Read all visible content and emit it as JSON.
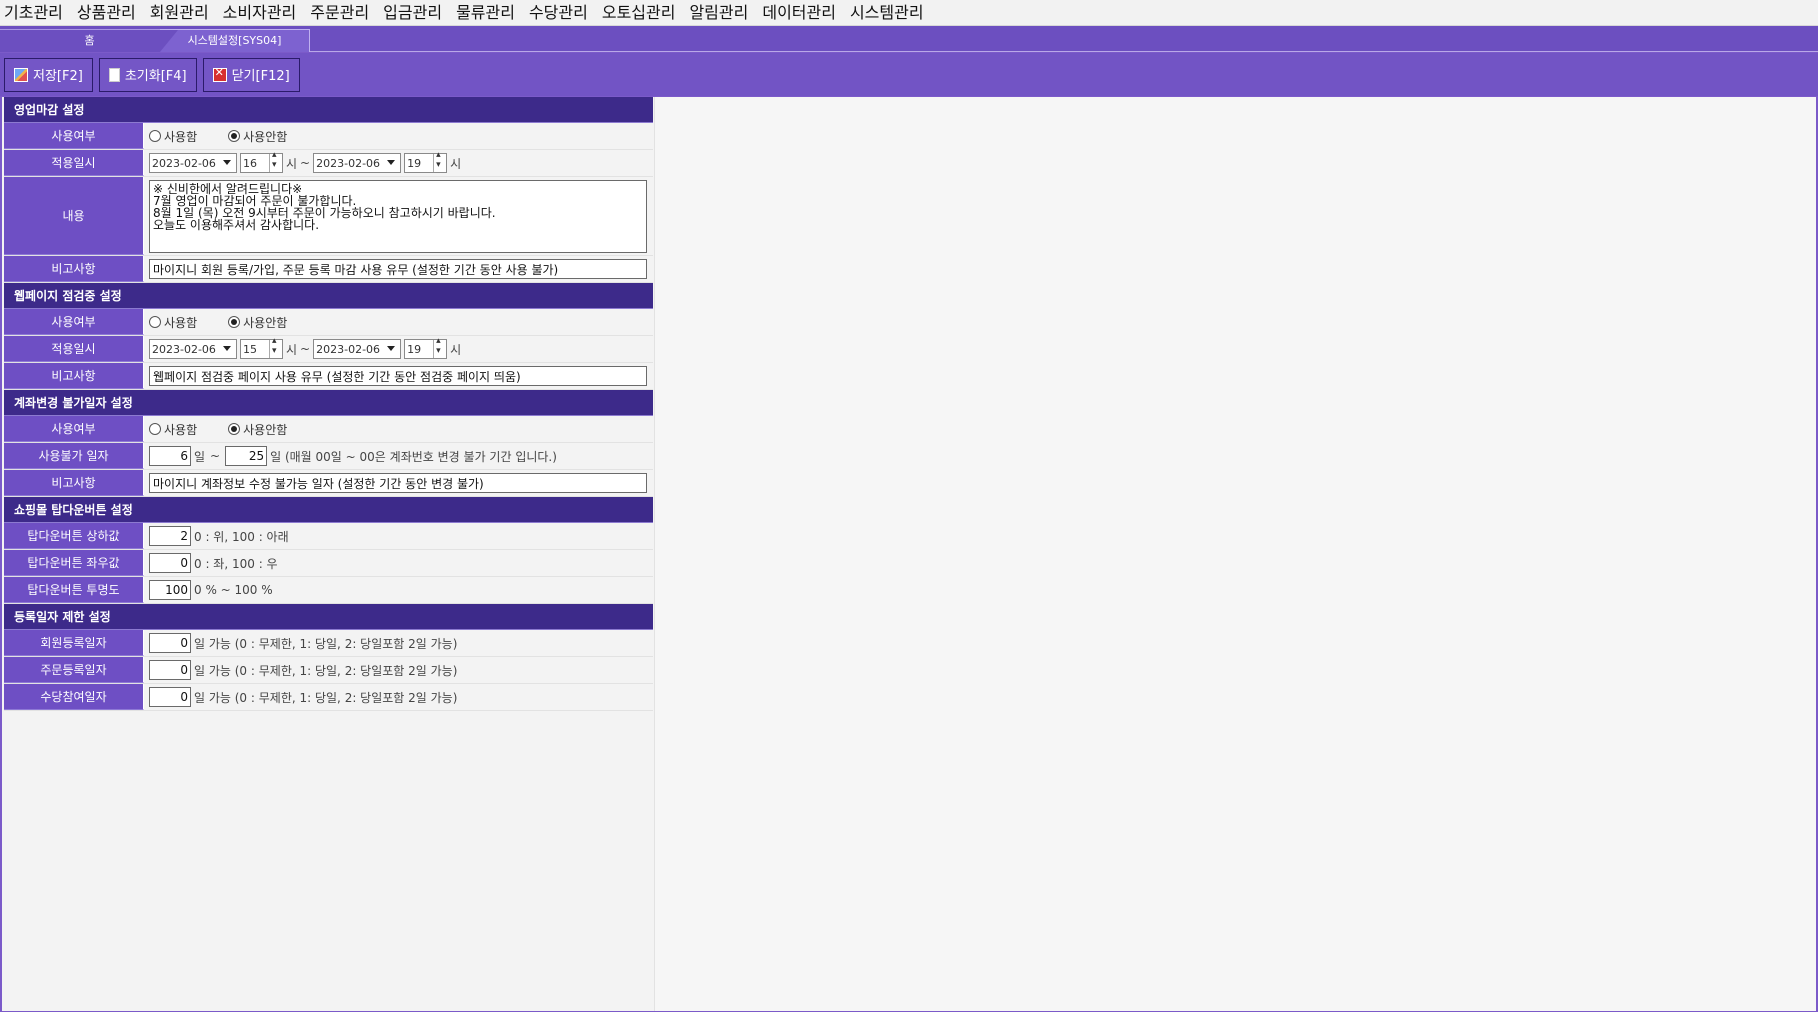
{
  "menu": [
    "기초관리",
    "상품관리",
    "회원관리",
    "소비자관리",
    "주문관리",
    "입금관리",
    "물류관리",
    "수당관리",
    "오토십관리",
    "알림관리",
    "데이터관리",
    "시스템관리"
  ],
  "tabs": {
    "home": "홈",
    "active": "시스템설정[SYS04]"
  },
  "toolbar": {
    "save": "저장[F2]",
    "reset": "초기화[F4]",
    "close": "닫기[F12]"
  },
  "radio": {
    "use": "사용함",
    "nouse": "사용안함"
  },
  "units": {
    "hour": "시",
    "tilde": "~",
    "day": "일"
  },
  "business_close": {
    "title": "영업마감 설정",
    "use_label": "사용여부",
    "period_label": "적용일시",
    "start_date": "2023-02-06",
    "start_hour": "16",
    "end_date": "2023-02-06",
    "end_hour": "19",
    "content_label": "내용",
    "content": "※ 신비한에서 알려드립니다※\n7월 영업이 마감되어 주문이 불가합니다.\n8월 1일 (목) 오전 9시부터 주문이 가능하오니 참고하시기 바랍니다.\n오늘도 이용해주셔서 감사합니다.",
    "note_label": "비고사항",
    "note": "마이지니 회원 등록/가입, 주문 등록 마감 사용 유무 (설정한 기간 동안 사용 불가)"
  },
  "maintenance": {
    "title": "웹페이지 점검중 설정",
    "use_label": "사용여부",
    "period_label": "적용일시",
    "start_date": "2023-02-06",
    "start_hour": "15",
    "end_date": "2023-02-06",
    "end_hour": "19",
    "note_label": "비고사항",
    "note": "웹페이지 점검중 페이지 사용 유무 (설정한 기간 동안 점검중 페이지 띄움)"
  },
  "account_change": {
    "title": "계좌변경 불가일자 설정",
    "use_label": "사용여부",
    "days_label": "사용불가 일자",
    "from_day": "6",
    "to_day": "25",
    "days_hint": "일 (매월 00일 ~ 00은 계좌번호 변경 불가 기간 입니다.)",
    "note_label": "비고사항",
    "note": "마이지니 계좌정보 수정 불가능 일자 (설정한 기간 동안 변경 불가)"
  },
  "topdown": {
    "title": "쇼핑몰 탑다운버튼 설정",
    "vert_label": "탑다운버튼 상하값",
    "vert_value": "2",
    "vert_hint": "0 : 위, 100 : 아래",
    "horiz_label": "탑다운버튼 좌우값",
    "horiz_value": "0",
    "horiz_hint": "0 : 좌, 100 : 우",
    "opacity_label": "탑다운버튼 투명도",
    "opacity_value": "100",
    "opacity_hint": "0 % ~ 100 %"
  },
  "reg_limit": {
    "title": "등록일자 제한 설정",
    "member_label": "회원등록일자",
    "member_value": "0",
    "order_label": "주문등록일자",
    "order_value": "0",
    "bonus_label": "수당참여일자",
    "bonus_value": "0",
    "hint": "일 가능 (0 : 무제한, 1: 당일, 2: 당일포함 2일 가능)"
  }
}
